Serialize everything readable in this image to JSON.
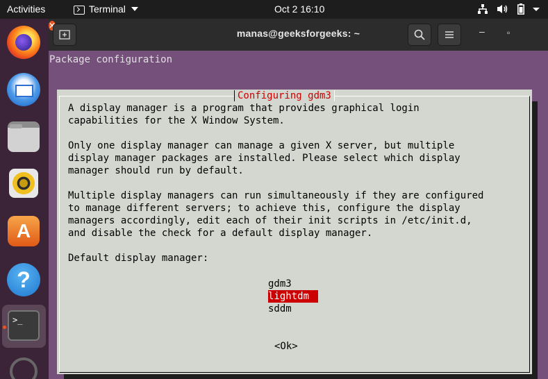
{
  "topbar": {
    "activities": "Activities",
    "app_name": "Terminal",
    "clock": "Oct 2  16:10"
  },
  "dock": {
    "items": [
      "firefox",
      "thunderbird",
      "files",
      "rhythmbox",
      "software",
      "help",
      "terminal"
    ],
    "software_glyph": "A",
    "help_glyph": "?",
    "terminal_glyph": ">_"
  },
  "window": {
    "title": "manas@geeksforgeeks: ~",
    "minimize_glyph": "–",
    "maximize_glyph": "▫",
    "close_glyph": "✕"
  },
  "terminal": {
    "package_config_title": "Package configuration",
    "dialog": {
      "title": "Configuring gdm3",
      "body": "A display manager is a program that provides graphical login\ncapabilities for the X Window System.\n\nOnly one display manager can manage a given X server, but multiple\ndisplay manager packages are installed. Please select which display\nmanager should run by default.\n\nMultiple display managers can run simultaneously if they are configured\nto manage different servers; to achieve this, configure the display\nmanagers accordingly, edit each of their init scripts in /etc/init.d,\nand disable the check for a default display manager.\n\nDefault display manager:",
      "options": [
        "gdm3",
        "lightdm",
        "sddm"
      ],
      "selected": "lightdm",
      "ok_label": "<Ok>"
    }
  },
  "colors": {
    "terminal_bg": "#75507b",
    "dialog_bg": "#d3d7cf",
    "dialog_title": "#cc0000",
    "selection_bg": "#cc0000",
    "accent": "#e95420"
  }
}
